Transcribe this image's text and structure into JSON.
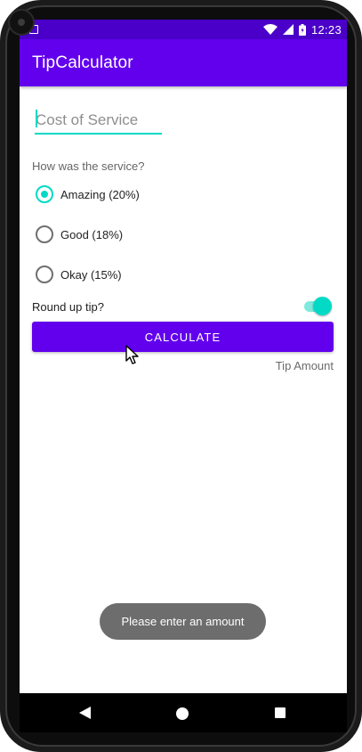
{
  "status_bar": {
    "time": "12:23",
    "icons": [
      "wifi-icon",
      "signal-icon",
      "battery-icon"
    ]
  },
  "app_bar": {
    "title": "TipCalculator"
  },
  "form": {
    "cost_placeholder": "Cost of Service",
    "cost_value": "",
    "question": "How was the service?",
    "options": [
      {
        "label": "Amazing (20%)",
        "checked": true
      },
      {
        "label": "Good (18%)",
        "checked": false
      },
      {
        "label": "Okay (15%)",
        "checked": false
      }
    ],
    "round_up_label": "Round up tip?",
    "round_up_on": true,
    "calculate_label": "CALCULATE",
    "tip_amount_label": "Tip Amount"
  },
  "toast": {
    "message": "Please enter an amount"
  },
  "colors": {
    "primary": "#6200ee",
    "primary_dark": "#4a00c8",
    "accent": "#03dac5",
    "toast_bg": "#6d6d6d"
  },
  "nav": {
    "icons": [
      "back-icon",
      "home-icon",
      "recents-icon"
    ]
  }
}
